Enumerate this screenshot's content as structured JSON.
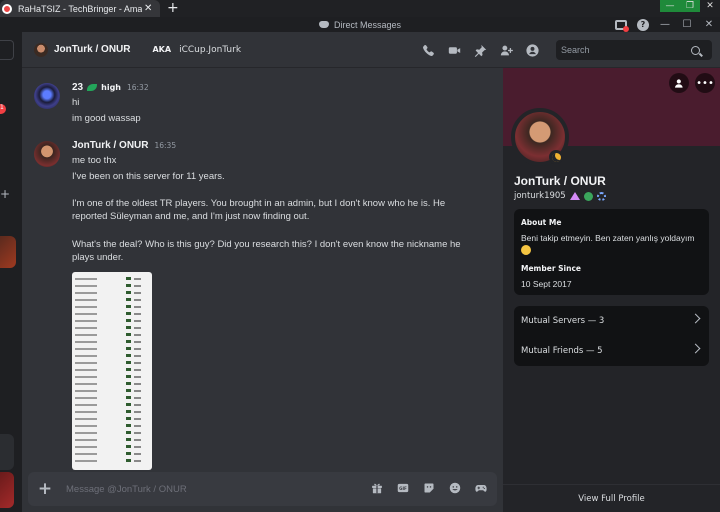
{
  "browser": {
    "tab_title": "RaHaTSIZ - TechBringer - Amazin",
    "tab_close": "✕",
    "new_tab": "+",
    "controls": [
      "—",
      "❐",
      "✕"
    ]
  },
  "window": {
    "title": "Direct Messages",
    "controls": [
      "—",
      "☐",
      "✕"
    ],
    "help": "?"
  },
  "left_strip": {
    "badge": "1",
    "plus": "+"
  },
  "header": {
    "name": "JonTurk / ONUR",
    "aka_label": "AKA",
    "aka_name": "iCCup.JonTurk",
    "search_placeholder": "Search"
  },
  "messages": [
    {
      "author": "23",
      "tag": "high",
      "time": "16:32",
      "lines": [
        "hi",
        "im good wassap"
      ]
    },
    {
      "author": "JonTurk / ONUR",
      "time": "16:35",
      "lines": [
        "me too thx",
        "I've been on this server for 11 years.",
        "I'm one of the oldest TR players. You brought in an admin, but I don't know who he is. He reported Süleyman and me, and I'm just now finding out.",
        "What's the deal? Who is this guy? Did you research this? I don't even know the nickname he plays under."
      ]
    }
  ],
  "composer": {
    "add": "+",
    "placeholder": "Message @JonTurk / ONUR"
  },
  "profile": {
    "display_name": "JonTurk / ONUR",
    "username": "jonturk1905",
    "about_label": "About Me",
    "about_text": "Beni takip etmeyin. Ben zaten yanlış yoldayım",
    "member_since_label": "Member Since",
    "member_since": "10 Sept 2017",
    "mutual_servers": "Mutual Servers — 3",
    "mutual_friends": "Mutual Friends — 5",
    "view_full": "View Full Profile",
    "more": "•••"
  },
  "colors": {
    "banner": "#4a1c2e",
    "accent_green": "#23a55a",
    "status_idle": "#f0b232"
  }
}
